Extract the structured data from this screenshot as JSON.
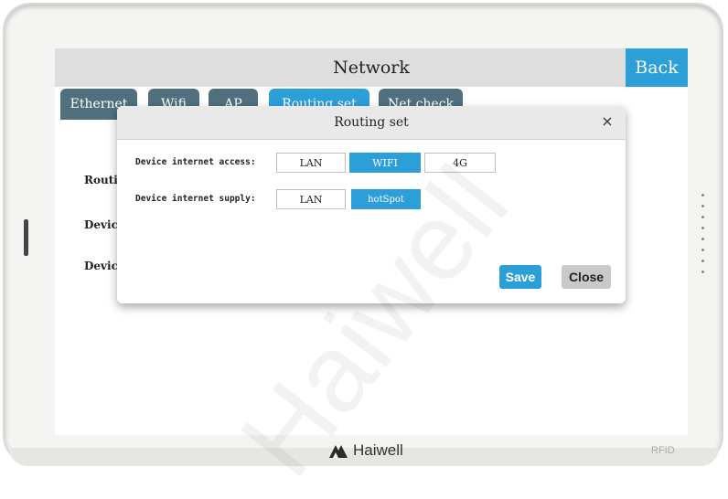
{
  "screen": {
    "title": "Network",
    "back_label": "Back",
    "tabs": [
      {
        "label": "Ethernet"
      },
      {
        "label": "Wifi"
      },
      {
        "label": "AP"
      },
      {
        "label": "Routing set"
      },
      {
        "label": "Net check"
      }
    ],
    "partial_labels": [
      "Routi",
      "Device",
      "Device"
    ]
  },
  "dialog": {
    "title": "Routing set",
    "close_glyph": "×",
    "access": {
      "label": "Device internet access:",
      "options": [
        "LAN",
        "WIFI",
        "4G"
      ],
      "selected": "WIFI"
    },
    "supply": {
      "label": "Device internet supply:",
      "options": [
        "LAN",
        "hotSpot"
      ],
      "selected": "hotSpot"
    },
    "save_label": "Save",
    "close_label": "Close"
  },
  "watermark": "Haiwell",
  "brand": "Haiwell",
  "rfid_label": "RFID",
  "colors": {
    "accent": "#2c9ed8",
    "tab": "#50707d",
    "titlebar": "#dedede"
  }
}
